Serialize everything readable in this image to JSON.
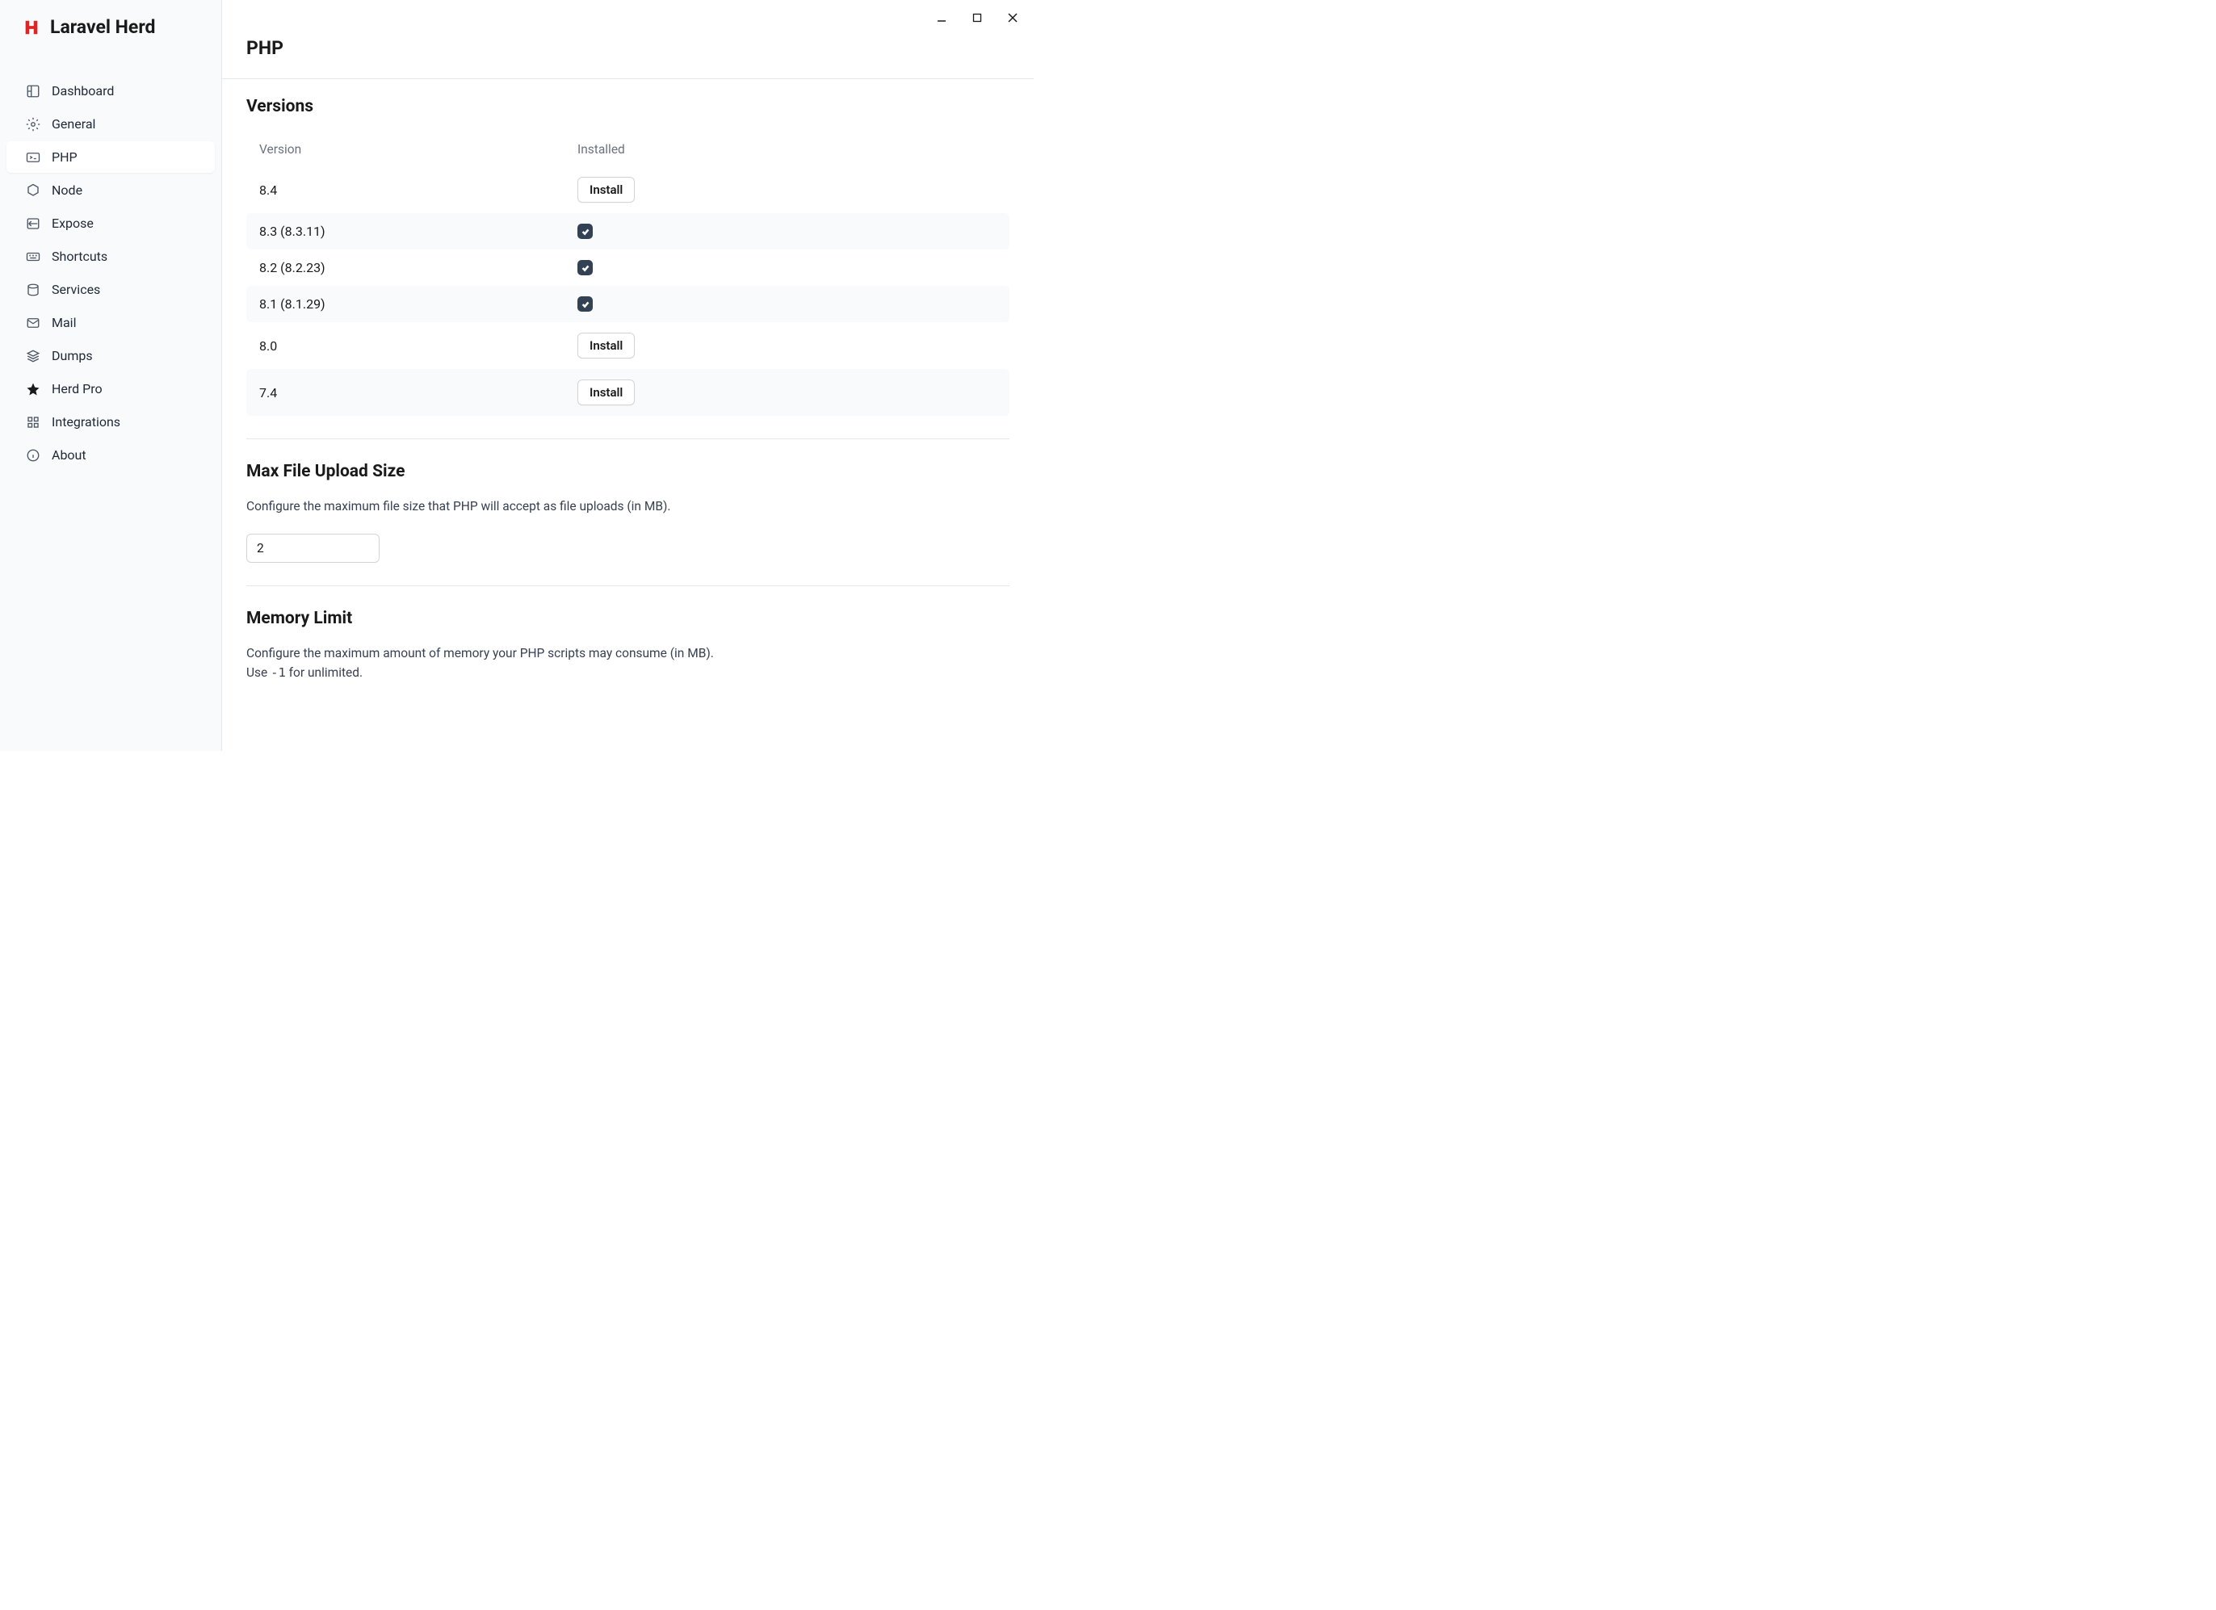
{
  "app": {
    "title": "Laravel Herd"
  },
  "sidebar": {
    "items": [
      {
        "label": "Dashboard",
        "icon": "dashboard"
      },
      {
        "label": "General",
        "icon": "gear"
      },
      {
        "label": "PHP",
        "icon": "terminal",
        "active": true
      },
      {
        "label": "Node",
        "icon": "node"
      },
      {
        "label": "Expose",
        "icon": "share"
      },
      {
        "label": "Shortcuts",
        "icon": "keyboard"
      },
      {
        "label": "Services",
        "icon": "database"
      },
      {
        "label": "Mail",
        "icon": "mail"
      },
      {
        "label": "Dumps",
        "icon": "stack"
      },
      {
        "label": "Herd Pro",
        "icon": "star"
      },
      {
        "label": "Integrations",
        "icon": "grid"
      },
      {
        "label": "About",
        "icon": "info"
      }
    ]
  },
  "page": {
    "title": "PHP"
  },
  "versions": {
    "title": "Versions",
    "col_version": "Version",
    "col_installed": "Installed",
    "install_label": "Install",
    "rows": [
      {
        "version": "8.4",
        "installed": false
      },
      {
        "version": "8.3 (8.3.11)",
        "installed": true
      },
      {
        "version": "8.2 (8.2.23)",
        "installed": true
      },
      {
        "version": "8.1 (8.1.29)",
        "installed": true
      },
      {
        "version": "8.0",
        "installed": false
      },
      {
        "version": "7.4",
        "installed": false
      }
    ]
  },
  "upload": {
    "title": "Max File Upload Size",
    "desc": "Configure the maximum file size that PHP will accept as file uploads (in MB).",
    "value": "2"
  },
  "memory": {
    "title": "Memory Limit",
    "desc_part1": "Configure the maximum amount of memory your PHP scripts may consume (in MB).",
    "desc_part2a": "Use ",
    "desc_code": "-1",
    "desc_part2b": " for unlimited."
  }
}
